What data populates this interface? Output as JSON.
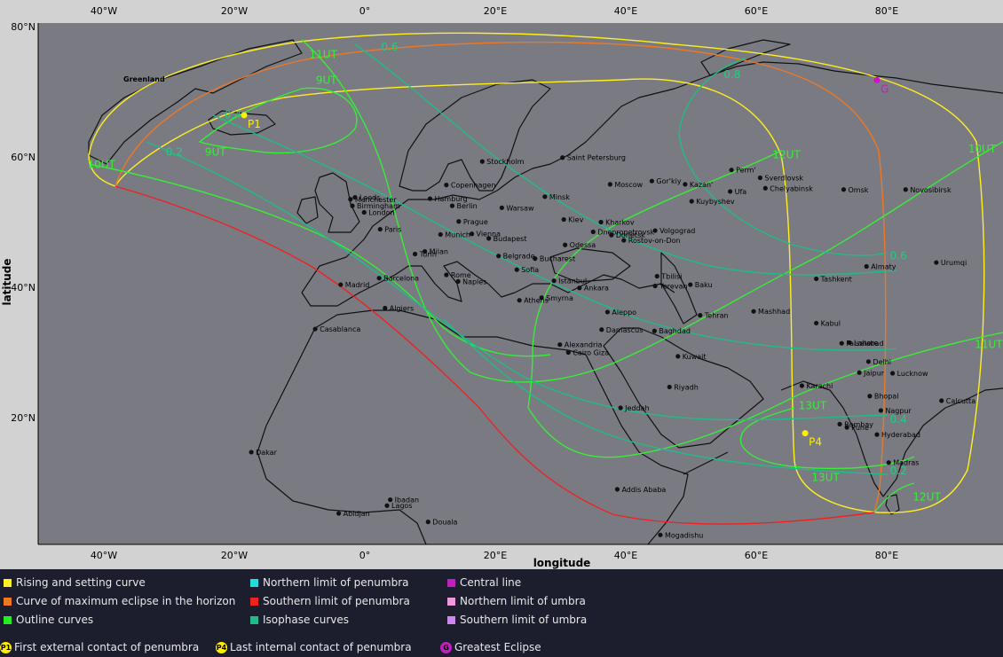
{
  "map": {
    "axes": {
      "x_title": "longitude",
      "y_title": "latitude",
      "lon_ticks": [
        "40°W",
        "20°W",
        "0°",
        "20°E",
        "40°E",
        "60°E",
        "80°E"
      ],
      "lat_ticks": [
        "80°N",
        "60°N",
        "40°N",
        "20°N"
      ]
    },
    "places": [
      {
        "name": "Greenland",
        "lon": -37,
        "lat": 72,
        "dot": false
      },
      {
        "name": "Stockholm",
        "lon": 18,
        "lat": 59.3
      },
      {
        "name": "Saint Petersburg",
        "lon": 30.3,
        "lat": 59.9
      },
      {
        "name": "Copenhagen",
        "lon": 12.5,
        "lat": 55.7
      },
      {
        "name": "Moscow",
        "lon": 37.6,
        "lat": 55.8
      },
      {
        "name": "Gor'kiy",
        "lon": 44,
        "lat": 56.3
      },
      {
        "name": "Kazan'",
        "lon": 49.1,
        "lat": 55.8
      },
      {
        "name": "Perm'",
        "lon": 56.2,
        "lat": 58
      },
      {
        "name": "Sverdlovsk",
        "lon": 60.6,
        "lat": 56.8
      },
      {
        "name": "Ufa",
        "lon": 56,
        "lat": 54.7
      },
      {
        "name": "Chelyabinsk",
        "lon": 61.4,
        "lat": 55.2
      },
      {
        "name": "Omsk",
        "lon": 73.4,
        "lat": 55
      },
      {
        "name": "Novosibirsk",
        "lon": 82.9,
        "lat": 55
      },
      {
        "name": "Kuybyshev",
        "lon": 50.1,
        "lat": 53.2
      },
      {
        "name": "Minsk",
        "lon": 27.6,
        "lat": 53.9
      },
      {
        "name": "Warsaw",
        "lon": 21,
        "lat": 52.2
      },
      {
        "name": "Berlin",
        "lon": 13.4,
        "lat": 52.5
      },
      {
        "name": "Hamburg",
        "lon": 10,
        "lat": 53.6
      },
      {
        "name": "Manchester",
        "lon": -2.2,
        "lat": 53.5
      },
      {
        "name": "Leeds",
        "lon": -1.5,
        "lat": 53.8
      },
      {
        "name": "Birmingham",
        "lon": -1.9,
        "lat": 52.5
      },
      {
        "name": "London",
        "lon": -0.1,
        "lat": 51.5
      },
      {
        "name": "Paris",
        "lon": 2.35,
        "lat": 48.9
      },
      {
        "name": "Prague",
        "lon": 14.4,
        "lat": 50.1
      },
      {
        "name": "Vienna",
        "lon": 16.4,
        "lat": 48.2
      },
      {
        "name": "Munich",
        "lon": 11.6,
        "lat": 48.1
      },
      {
        "name": "Budapest",
        "lon": 19,
        "lat": 47.5
      },
      {
        "name": "Kiev",
        "lon": 30.5,
        "lat": 50.4
      },
      {
        "name": "Kharkov",
        "lon": 36.2,
        "lat": 50
      },
      {
        "name": "Dnepropetrovsk",
        "lon": 35,
        "lat": 48.5
      },
      {
        "name": "Donetsk",
        "lon": 37.8,
        "lat": 48
      },
      {
        "name": "Volgograd",
        "lon": 44.5,
        "lat": 48.7
      },
      {
        "name": "Rostov-on-Don",
        "lon": 39.7,
        "lat": 47.2
      },
      {
        "name": "Odessa",
        "lon": 30.7,
        "lat": 46.5
      },
      {
        "name": "Bucharest",
        "lon": 26.1,
        "lat": 44.4
      },
      {
        "name": "Belgrade",
        "lon": 20.5,
        "lat": 44.8
      },
      {
        "name": "Sofia",
        "lon": 23.3,
        "lat": 42.7
      },
      {
        "name": "Turin",
        "lon": 7.7,
        "lat": 45.1
      },
      {
        "name": "Milan",
        "lon": 9.2,
        "lat": 45.5
      },
      {
        "name": "Rome",
        "lon": 12.5,
        "lat": 41.9
      },
      {
        "name": "Naples",
        "lon": 14.3,
        "lat": 40.9
      },
      {
        "name": "Barcelona",
        "lon": 2.2,
        "lat": 41.4
      },
      {
        "name": "Madrid",
        "lon": -3.7,
        "lat": 40.4
      },
      {
        "name": "Algiers",
        "lon": 3.1,
        "lat": 36.8
      },
      {
        "name": "Casablanca",
        "lon": -7.6,
        "lat": 33.6
      },
      {
        "name": "Istanbul",
        "lon": 29,
        "lat": 41
      },
      {
        "name": "Ankara",
        "lon": 32.9,
        "lat": 39.9
      },
      {
        "name": "Smyrna",
        "lon": 27.1,
        "lat": 38.4
      },
      {
        "name": "Athens",
        "lon": 23.7,
        "lat": 38
      },
      {
        "name": "Tbilisi",
        "lon": 44.8,
        "lat": 41.7
      },
      {
        "name": "Yerevan",
        "lon": 44.5,
        "lat": 40.2
      },
      {
        "name": "Baku",
        "lon": 49.9,
        "lat": 40.4
      },
      {
        "name": "Tehran",
        "lon": 51.4,
        "lat": 35.7
      },
      {
        "name": "Mashhad",
        "lon": 59.6,
        "lat": 36.3
      },
      {
        "name": "Tashkent",
        "lon": 69.2,
        "lat": 41.3
      },
      {
        "name": "Almaty",
        "lon": 76.9,
        "lat": 43.2
      },
      {
        "name": "Urumqi",
        "lon": 87.6,
        "lat": 43.8
      },
      {
        "name": "Kabul",
        "lon": 69.2,
        "lat": 34.5
      },
      {
        "name": "Lahore",
        "lon": 74.3,
        "lat": 31.5
      },
      {
        "name": "Faisalabad",
        "lon": 73.1,
        "lat": 31.4
      },
      {
        "name": "Delhi",
        "lon": 77.2,
        "lat": 28.6
      },
      {
        "name": "Jaipur",
        "lon": 75.8,
        "lat": 26.9
      },
      {
        "name": "Lucknow",
        "lon": 80.9,
        "lat": 26.8
      },
      {
        "name": "Karachi",
        "lon": 67,
        "lat": 24.9
      },
      {
        "name": "Bhopal",
        "lon": 77.4,
        "lat": 23.3
      },
      {
        "name": "Calcutta",
        "lon": 88.4,
        "lat": 22.6
      },
      {
        "name": "Nagpur",
        "lon": 79.1,
        "lat": 21.1
      },
      {
        "name": "Bombay",
        "lon": 72.8,
        "lat": 19
      },
      {
        "name": "Pune",
        "lon": 73.9,
        "lat": 18.5
      },
      {
        "name": "Hyderabad",
        "lon": 78.5,
        "lat": 17.4
      },
      {
        "name": "Madras",
        "lon": 80.3,
        "lat": 13.1
      },
      {
        "name": "Aleppo",
        "lon": 37.2,
        "lat": 36.2
      },
      {
        "name": "Damascus",
        "lon": 36.3,
        "lat": 33.5
      },
      {
        "name": "Baghdad",
        "lon": 44.4,
        "lat": 33.3
      },
      {
        "name": "Kuwait",
        "lon": 48,
        "lat": 29.4
      },
      {
        "name": "Riyadh",
        "lon": 46.7,
        "lat": 24.7
      },
      {
        "name": "Jeddah",
        "lon": 39.2,
        "lat": 21.5
      },
      {
        "name": "Alexandria",
        "lon": 29.9,
        "lat": 31.2
      },
      {
        "name": "Cairo Giza",
        "lon": 31.2,
        "lat": 30
      },
      {
        "name": "Addis Ababa",
        "lon": 38.7,
        "lat": 9
      },
      {
        "name": "Mogadishu",
        "lon": 45.3,
        "lat": 2
      },
      {
        "name": "Ibadan",
        "lon": 3.9,
        "lat": 7.4
      },
      {
        "name": "Lagos",
        "lon": 3.4,
        "lat": 6.5
      },
      {
        "name": "Abidjan",
        "lon": -4,
        "lat": 5.3
      },
      {
        "name": "Douala",
        "lon": 9.7,
        "lat": 4
      },
      {
        "name": "Dakar",
        "lon": -17.4,
        "lat": 14.7
      }
    ],
    "curve_labels": [
      {
        "text": "11UT",
        "lon": -8.5,
        "lat": 75.2,
        "kind": "outline"
      },
      {
        "text": "9UT",
        "lon": -7.5,
        "lat": 71.2,
        "kind": "outline"
      },
      {
        "text": "9UT",
        "lon": -24.5,
        "lat": 60.2,
        "kind": "outline"
      },
      {
        "text": "10UT",
        "lon": -42.5,
        "lat": 58.3,
        "kind": "outline"
      },
      {
        "text": "12UT",
        "lon": 62.5,
        "lat": 59.8,
        "kind": "outline"
      },
      {
        "text": "10UT",
        "lon": 92.5,
        "lat": 60.7,
        "kind": "outline"
      },
      {
        "text": "11UT",
        "lon": 93.5,
        "lat": 30.7,
        "kind": "outline"
      },
      {
        "text": "13UT",
        "lon": 66.5,
        "lat": 21.3,
        "kind": "outline"
      },
      {
        "text": "13UT",
        "lon": 68.5,
        "lat": 10.3,
        "kind": "outline"
      },
      {
        "text": "12UT",
        "lon": 84,
        "lat": 7.3,
        "kind": "outline"
      },
      {
        "text": "0.6",
        "lon": 2.5,
        "lat": 76.3,
        "kind": "iso"
      },
      {
        "text": "0.8",
        "lon": 55,
        "lat": 72.1,
        "kind": "iso"
      },
      {
        "text": "0.4",
        "lon": -21.5,
        "lat": 65.9,
        "kind": "iso"
      },
      {
        "text": "0.2",
        "lon": -30.5,
        "lat": 60.2,
        "kind": "iso"
      },
      {
        "text": "0.6",
        "lon": 80.5,
        "lat": 44.3,
        "kind": "iso"
      },
      {
        "text": "0.4",
        "lon": 80.5,
        "lat": 19.2,
        "kind": "iso"
      },
      {
        "text": "0.2",
        "lon": 80.5,
        "lat": 11.3,
        "kind": "iso"
      }
    ],
    "markers": [
      {
        "label": "P1",
        "lon": -18.5,
        "lat": 66.4,
        "color": "#ffee00"
      },
      {
        "label": "P4",
        "lon": 67.5,
        "lat": 17.6,
        "color": "#ffee00"
      },
      {
        "label": "G",
        "lon": 78.5,
        "lat": 71.8,
        "color": "#d010d0"
      }
    ]
  },
  "legend": {
    "rows": [
      [
        {
          "label": "Rising and setting curve",
          "color": "#ffee22"
        },
        {
          "label": "Northern limit of penumbra",
          "color": "#22dddd"
        },
        {
          "label": "Central line",
          "color": "#c020c0"
        }
      ],
      [
        {
          "label": "Curve of maximum eclipse in the horizon",
          "color": "#ee7722"
        },
        {
          "label": "Southern limit of penumbra",
          "color": "#ee2222"
        },
        {
          "label": "Northern limit of umbra",
          "color": "#ee99dd"
        }
      ],
      [
        {
          "label": "Outline curves",
          "color": "#22ee22"
        },
        {
          "label": "Isophase curves",
          "color": "#20bb88"
        },
        {
          "label": "Southern limit of umbra",
          "color": "#cc88ee"
        }
      ]
    ],
    "markers": [
      {
        "symbol": "P1",
        "label": "First external contact of penumbra",
        "color": "#ffee00"
      },
      {
        "symbol": "P4",
        "label": "Last  internal contact of penumbra",
        "color": "#ffee00"
      },
      {
        "symbol": "G",
        "label": "Greatest Eclipse",
        "color": "#c020c0"
      }
    ]
  }
}
